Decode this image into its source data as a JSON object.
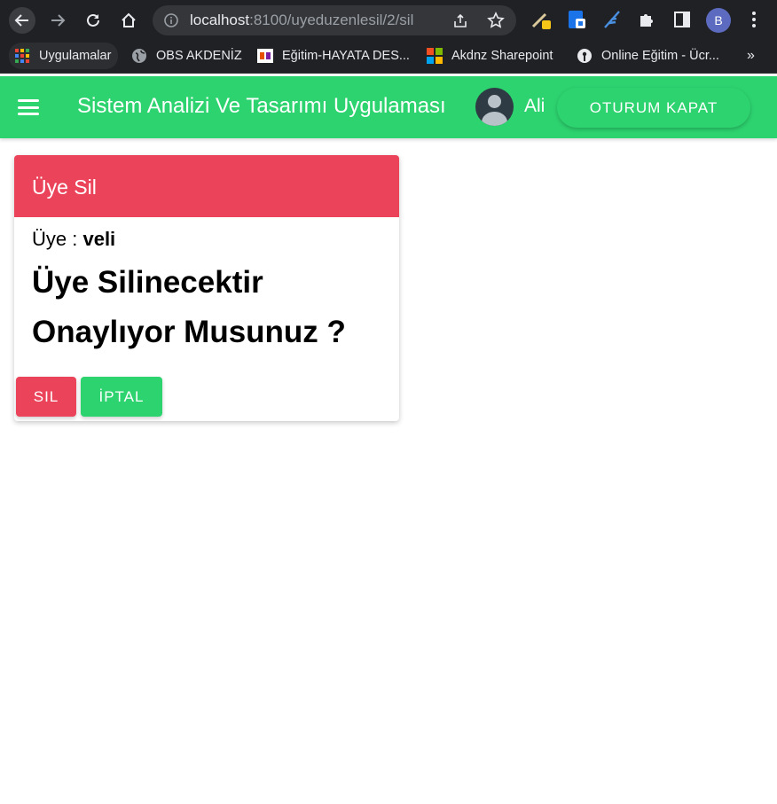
{
  "browser": {
    "url_host": "localhost",
    "url_path": ":8100/uyeduzenlesil/2/sil",
    "profile_initial": "B",
    "bookmarks": [
      {
        "label": "Uygulamalar",
        "icon": "apps-grid-icon"
      },
      {
        "label": "OBS AKDENİZ",
        "icon": "globe-icon"
      },
      {
        "label": "Eğitim-HAYATA DES...",
        "icon": "site-favicon-icon"
      },
      {
        "label": "Akdnz Sharepoint",
        "icon": "microsoft-logo-icon"
      },
      {
        "label": "Online Eğitim - Ücr...",
        "icon": "podcast-icon"
      }
    ],
    "more_bookmarks": "»"
  },
  "toolbar": {
    "title": "Sistem Analizi Ve Tasarımı Uygulaması",
    "user_name": "Ali",
    "logout_label": "OTURUM KAPAT",
    "color": "#2dd36f"
  },
  "card": {
    "header_title": "Üye Sil",
    "header_color": "#eb445a",
    "member_label": "Üye : ",
    "member_value": "veli",
    "confirm_line1": "Üye Silinecektir",
    "confirm_line2": "Onaylıyor Musunuz ?",
    "delete_label": "SIL",
    "cancel_label": "İPTAL"
  }
}
